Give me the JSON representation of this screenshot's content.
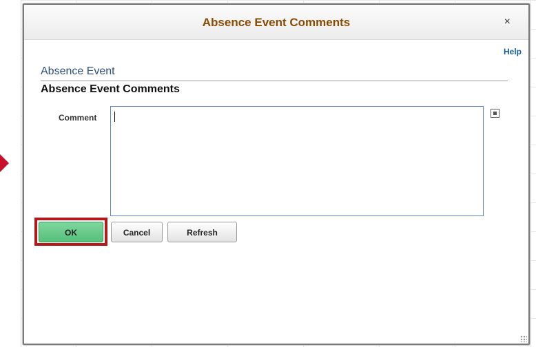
{
  "modal": {
    "title": "Absence Event Comments",
    "close_label": "×",
    "help_label": "Help"
  },
  "section": {
    "title": "Absence Event",
    "subtitle": "Absence Event Comments"
  },
  "comment": {
    "label": "Comment",
    "value": ""
  },
  "buttons": {
    "ok": "OK",
    "cancel": "Cancel",
    "refresh": "Refresh"
  },
  "colors": {
    "title": "#8a4a00",
    "section_title": "#2a4f7a",
    "ok_button": "#56c07b",
    "highlight_frame": "#b01a1a",
    "input_border": "#5c82c0",
    "help_link": "#1a5fa0"
  },
  "icons": {
    "expand": "expand-field-icon",
    "close": "close-icon",
    "arrow": "red-pointer-arrow",
    "resize": "resize-grip-icon"
  }
}
